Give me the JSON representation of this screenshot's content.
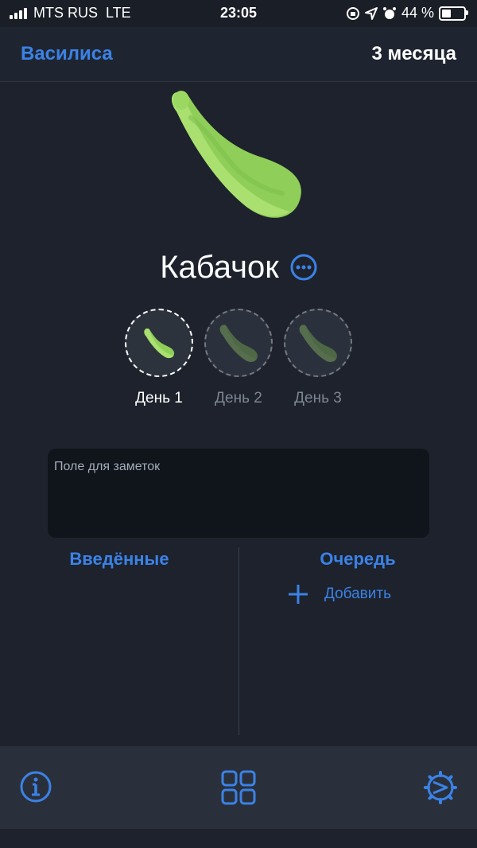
{
  "status_bar": {
    "carrier": "MTS RUS",
    "network": "LTE",
    "time": "23:05",
    "battery_percent": "44 %",
    "battery_level": 0.44,
    "icons": [
      "signal-icon",
      "orientation-lock-icon",
      "location-icon",
      "alarm-icon",
      "battery-icon"
    ]
  },
  "nav": {
    "back_label": "Василиса",
    "age_label": "3 месяца"
  },
  "food": {
    "name": "Кабачок",
    "icon": "zucchini-icon"
  },
  "days": [
    {
      "label": "День 1",
      "active": true
    },
    {
      "label": "День 2",
      "active": false
    },
    {
      "label": "День 3",
      "active": false
    }
  ],
  "notes": {
    "placeholder": "Поле для заметок",
    "value": ""
  },
  "columns": {
    "entered_title": "Введённые",
    "queue_title": "Очередь",
    "add_label": "Добавить"
  },
  "tab_bar": {
    "items": [
      "info-icon",
      "grid-icon",
      "settings-icon"
    ]
  },
  "colors": {
    "accent": "#3b82e6",
    "background": "#1d222c",
    "zucchini_light": "#a9e070",
    "zucchini_dark": "#7ec24e"
  }
}
